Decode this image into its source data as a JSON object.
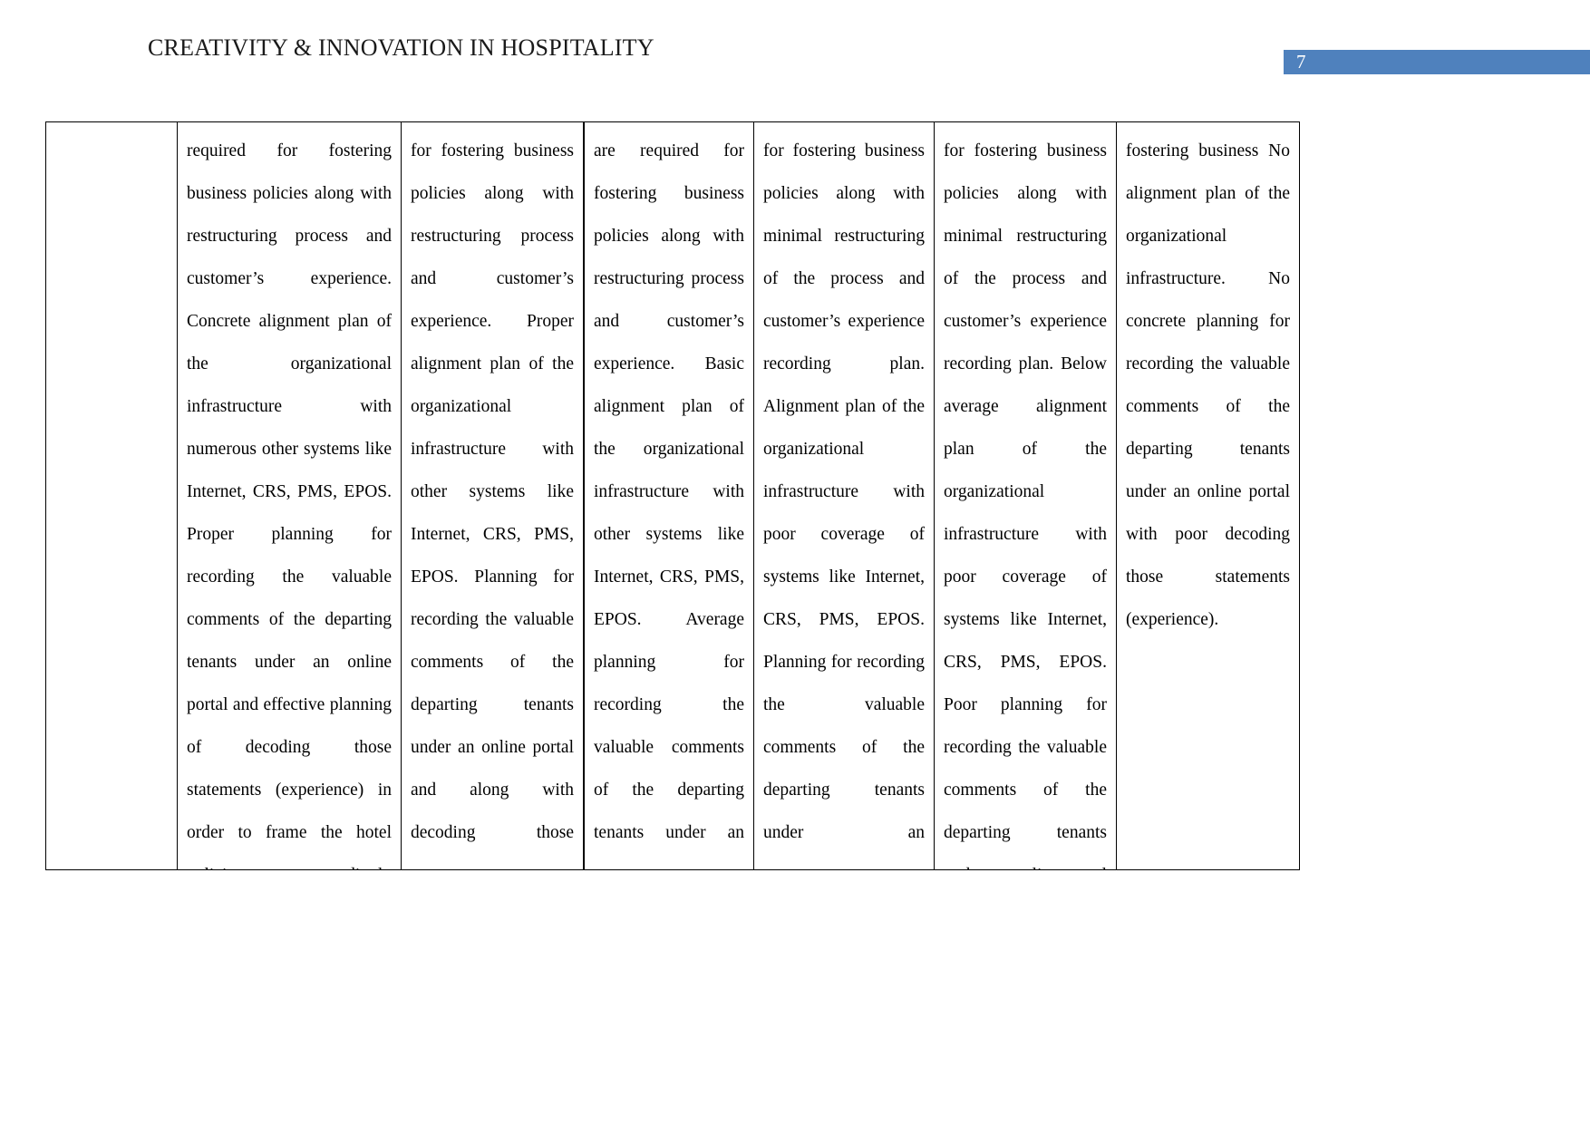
{
  "header": {
    "title": "CREATIVITY & INNOVATION IN HOSPITALITY",
    "page_number": "7",
    "badge_color": "#4F81BD"
  },
  "table": {
    "columns": [
      {
        "name": "criteria-column",
        "text": ""
      },
      {
        "name": "excellent-column",
        "text": "required for fostering business policies along with restructuring process and customer’s experience. Concrete alignment plan of the organizational infrastructure with numerous other systems like Internet, CRS, PMS, EPOS. Proper planning for recording the valuable comments of the departing tenants under an online portal and effective planning of decoding those statements (experience) in order to frame the hotel policies accordingly"
      },
      {
        "name": "very-good-column",
        "text": "for fostering business policies along with restructuring process and customer’s experience. Proper alignment plan of the organizational infrastructure with other systems like Internet, CRS, PMS, EPOS. Planning for recording the valuable comments of the departing tenants under an online portal and along with decoding those statements"
      },
      {
        "name": "good-column",
        "text": "are required for fostering business policies along with restructuring process and customer’s experience. Basic alignment plan of the organizational infrastructure with other systems like Internet, CRS, PMS, EPOS. Average planning for recording the valuable comments of the departing tenants under an"
      },
      {
        "name": "average-column",
        "text": "for fostering business policies along with minimal restructuring of the process and customer’s experience recording plan. Alignment plan of the organizational infrastructure with poor coverage of systems like Internet, CRS, PMS, EPOS. Planning for recording the valuable comments of the departing tenants under an"
      },
      {
        "name": "below-average-column",
        "text": "for fostering business policies along with minimal restructuring of the process and customer’s experience recording plan. Below average alignment plan of the organizational infrastructure with poor coverage of systems like Internet, CRS, PMS, EPOS. Poor planning for recording the valuable comments of the departing tenants under an online portal"
      },
      {
        "name": "poor-column",
        "text": "fostering business No alignment plan of the organizational infrastructure. No concrete planning for recording the valuable comments of the departing tenants under an online portal with poor decoding those statements (experience)."
      }
    ]
  }
}
